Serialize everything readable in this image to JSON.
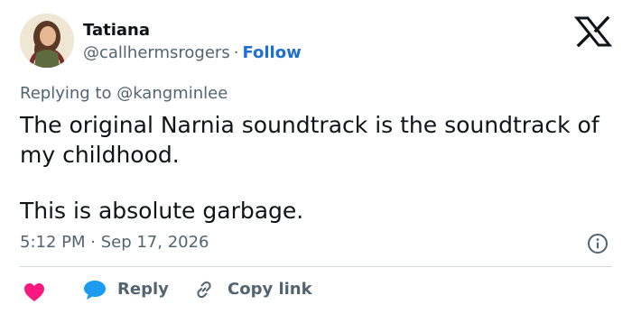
{
  "author": {
    "name": "Tatiana",
    "handle": "@callhermsrogers",
    "separator": "·",
    "follow_label": "Follow"
  },
  "replying_to": "Replying to @kangminlee",
  "body": {
    "line1": "The original Narnia soundtrack is the soundtrack of",
    "line2": "my childhood.",
    "line3": "This is absolute garbage."
  },
  "timestamp": "5:12 PM · Sep 17, 2026",
  "actions": {
    "reply_label": "Reply",
    "copy_link_label": "Copy link"
  },
  "icons": {
    "brand": "x-logo-icon",
    "info": "info-icon",
    "like": "heart-icon",
    "reply": "speech-bubble-icon",
    "copy": "link-icon"
  },
  "colors": {
    "text": "#0f1419",
    "secondary": "#536471",
    "follow": "#1d6fd1",
    "heart": "#f91880",
    "reply_bubble": "#1d9bf0",
    "divider": "#cfd9de"
  }
}
